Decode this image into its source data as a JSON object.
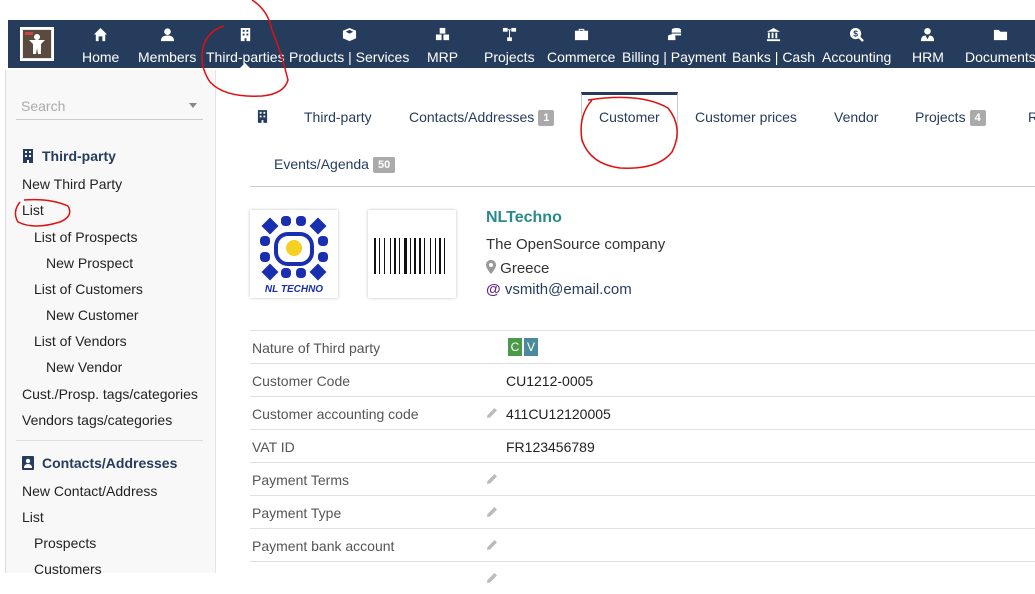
{
  "nav": {
    "items": [
      {
        "label": "Home",
        "icon": "home-icon"
      },
      {
        "label": "Members",
        "icon": "user-icon"
      },
      {
        "label": "Third-parties",
        "icon": "building-icon"
      },
      {
        "label": "Products | Services",
        "icon": "cube-icon"
      },
      {
        "label": "MRP",
        "icon": "cubes-icon"
      },
      {
        "label": "Projects",
        "icon": "sitemap-icon"
      },
      {
        "label": "Commerce",
        "icon": "suitcase-icon"
      },
      {
        "label": "Billing | Payment",
        "icon": "coins-icon"
      },
      {
        "label": "Banks | Cash",
        "icon": "bank-icon"
      },
      {
        "label": "Accounting",
        "icon": "dollar-search-icon"
      },
      {
        "label": "HRM",
        "icon": "user-tie-icon"
      },
      {
        "label": "Documents",
        "icon": "folder-icon"
      }
    ]
  },
  "sidebar": {
    "search_placeholder": "Search",
    "section1_title": "Third-party",
    "section1_items": [
      "New Third Party",
      "List",
      "List of Prospects",
      "New Prospect",
      "List of Customers",
      "New Customer",
      "List of Vendors",
      "New Vendor",
      "Cust./Prosp. tags/categories",
      "Vendors tags/categories"
    ],
    "section2_title": "Contacts/Addresses",
    "section2_items": [
      "New Contact/Address",
      "List",
      "Prospects",
      "Customers"
    ]
  },
  "tabs": {
    "third_party": "Third-party",
    "contacts": "Contacts/Addresses",
    "contacts_count": "1",
    "customer": "Customer",
    "customer_prices": "Customer prices",
    "vendor": "Vendor",
    "projects": "Projects",
    "projects_count": "4",
    "cut_off": "R",
    "events": "Events/Agenda",
    "events_count": "50"
  },
  "company": {
    "name": "NLTechno",
    "description": "The OpenSource company",
    "country": "Greece",
    "email": "vsmith@email.com",
    "logo_text": "NL TECHNO"
  },
  "fields": [
    {
      "label": "Nature of Third party",
      "value": ""
    },
    {
      "label": "Customer Code",
      "value": "CU1212-0005"
    },
    {
      "label": "Customer accounting code",
      "value": "411CU12120005"
    },
    {
      "label": "VAT ID",
      "value": "FR123456789"
    },
    {
      "label": "Payment Terms",
      "value": ""
    },
    {
      "label": "Payment Type",
      "value": ""
    },
    {
      "label": "Payment bank account",
      "value": ""
    }
  ],
  "nature_tags": [
    "C",
    "V"
  ],
  "colors": {
    "navbar": "#263c5c",
    "company_name": "#2a8a8a",
    "tag_c": "#4a9a4a",
    "tag_v": "#4a8a9a",
    "annotation": "#e01010"
  }
}
